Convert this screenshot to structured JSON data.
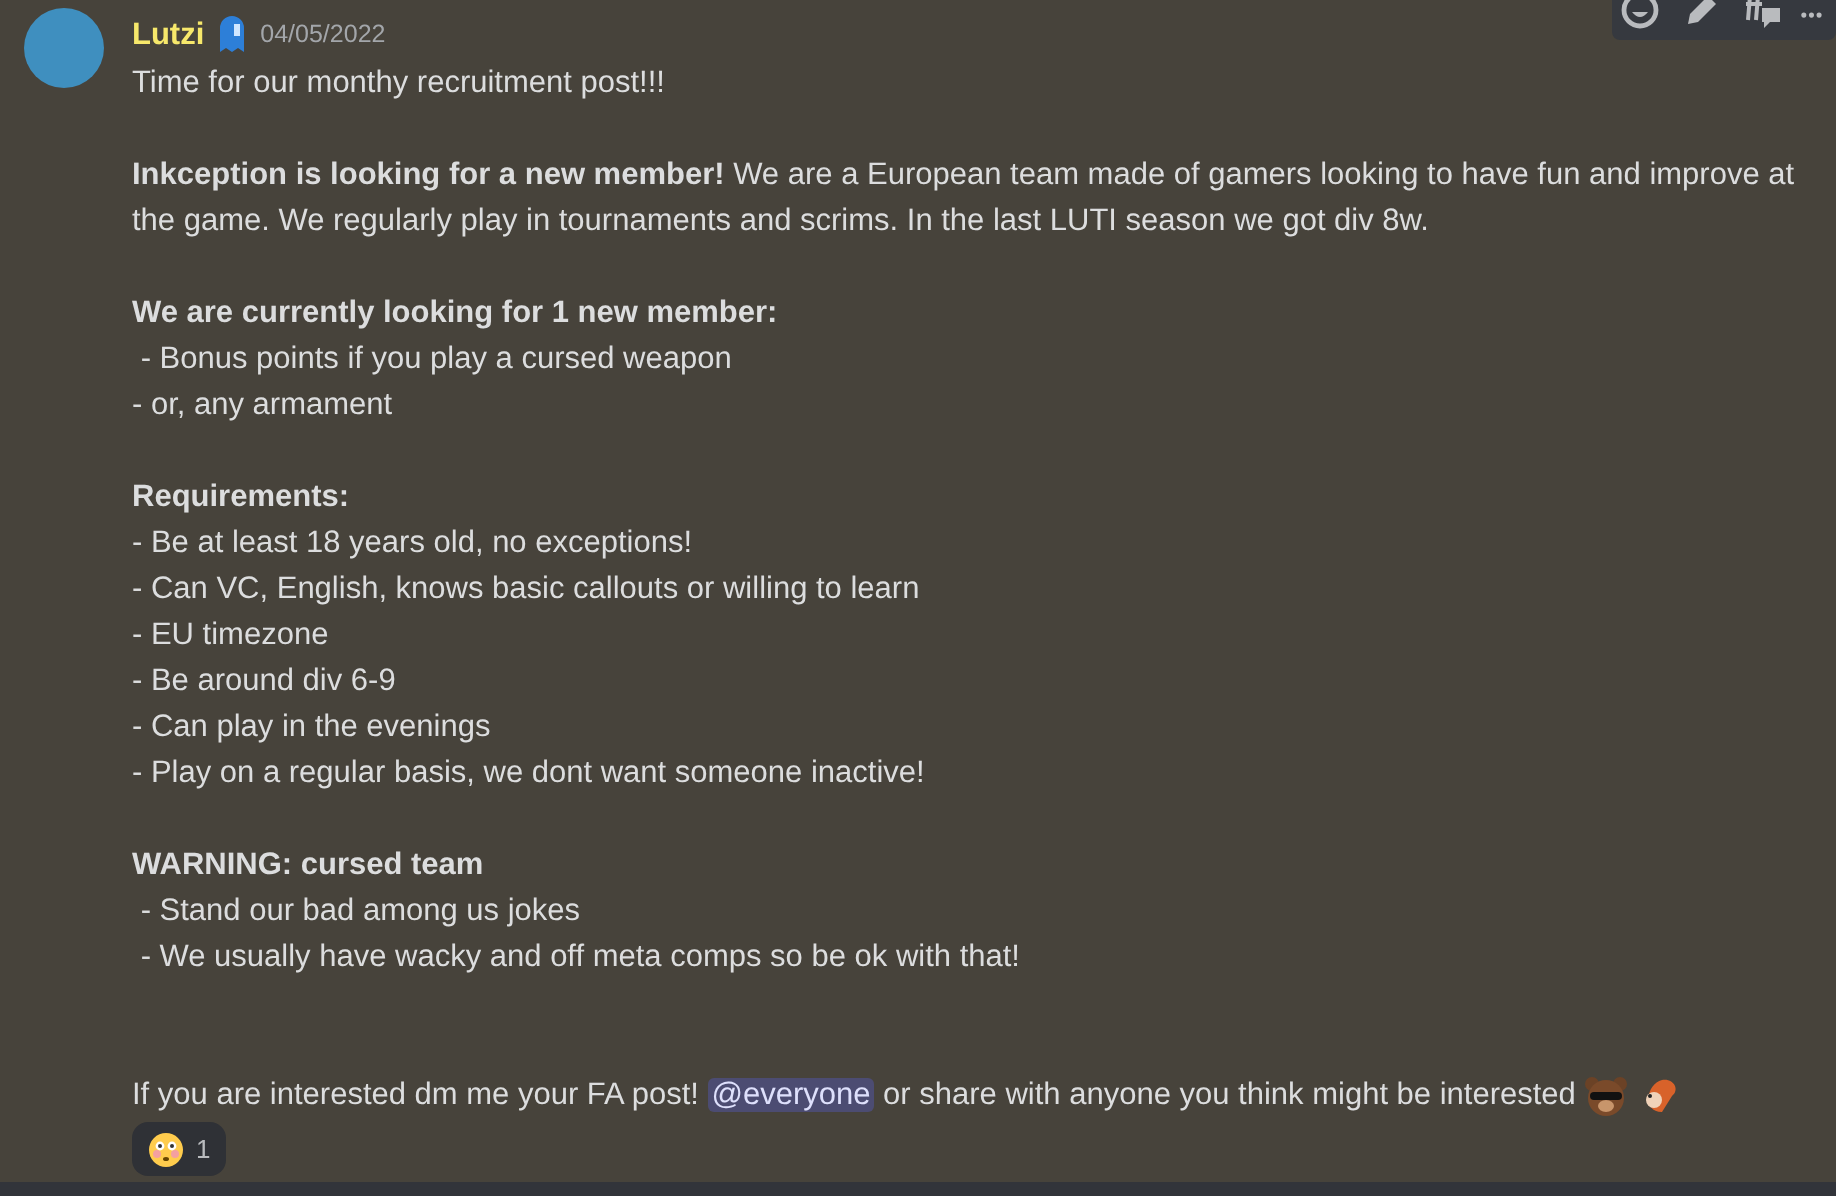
{
  "message": {
    "author": "Lutzi",
    "timestamp": "04/05/2022",
    "paragraphs": [
      {
        "lines": [
          "Time for our monthy recruitment post!!!"
        ]
      },
      {
        "lines": [
          "**Inkception is looking for a new member!** We are a European team made of gamers looking to have fun and improve at the game. We regularly play in tournaments and scrims. In the last LUTI season we got div 8w."
        ]
      },
      {
        "heading": "We are currently looking for 1 new member:",
        "lines": [
          " - Bonus points if you play a cursed weapon",
          "- or, any armament"
        ]
      },
      {
        "heading": "Requirements:",
        "lines": [
          "- Be at least 18 years old, no exceptions!",
          "- Can VC, English, knows basic callouts or willing to learn",
          "- EU timezone",
          "- Be around div 6-9",
          "- Can play in the evenings",
          "- Play on a regular basis, we dont want someone inactive!"
        ]
      },
      {
        "heading": "WARNING: cursed team",
        "lines": [
          " - Stand our bad among us jokes",
          " - We usually have wacky and off meta comps so be ok with that!"
        ]
      }
    ],
    "closing": {
      "before": "If you are interested dm me your FA post!",
      "mention": "@everyone",
      "after": "or share with anyone you think might be interested"
    },
    "reactions": [
      {
        "count": "1"
      }
    ]
  }
}
